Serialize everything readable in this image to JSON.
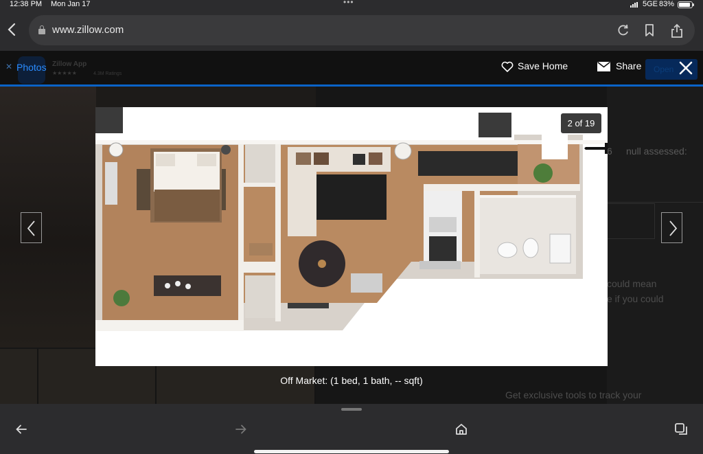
{
  "status_bar": {
    "time": "12:38 PM",
    "date": "Mon Jan 17",
    "network": "5GE",
    "battery": "83%"
  },
  "browser": {
    "url": "www.zillow.com"
  },
  "app_banner": {
    "name": "Zillow App",
    "stars": "★★★★★",
    "ratings": "4.3M Ratings"
  },
  "viewer": {
    "tab_label": "Photos",
    "save_label": "Save Home",
    "share_label": "Share",
    "open_label": "Open",
    "counter": "2 of 19",
    "caption": "Off Market: (1 bed, 1 bath, -- sqft)"
  },
  "background_page": {
    "assessed": "null assessed:",
    "assessed_prefix": "6",
    "text_line1": "could mean",
    "text_line2": "e if you could",
    "cta": "Get exclusive tools to track your"
  },
  "colors": {
    "accent": "#0a63c8",
    "tab_active": "#2a8cff",
    "toolbar": "#2c2c2e"
  }
}
